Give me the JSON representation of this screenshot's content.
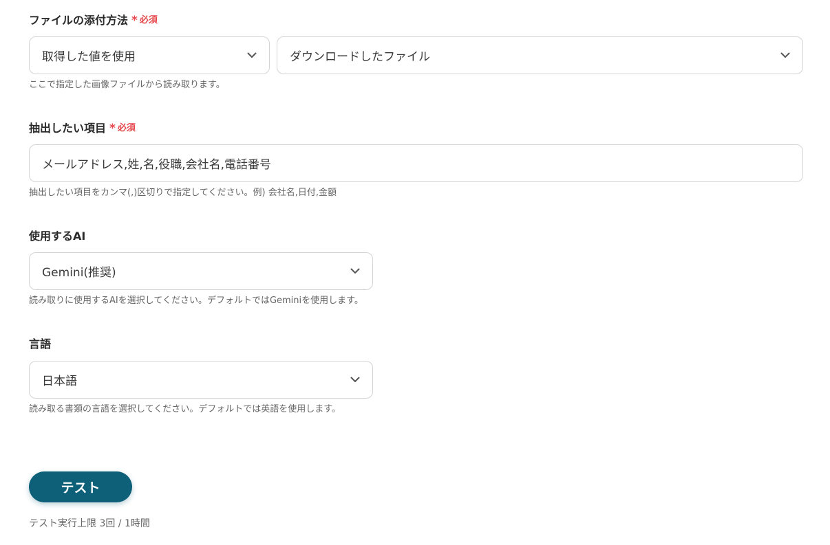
{
  "attachment": {
    "label": "ファイルの添付方法",
    "required_mark": "*",
    "required_text": "必須",
    "method_value": "取得した値を使用",
    "file_value": "ダウンロードしたファイル",
    "help": "ここで指定した画像ファイルから読み取ります。"
  },
  "extract": {
    "label": "抽出したい項目",
    "required_mark": "*",
    "required_text": "必須",
    "value": "メールアドレス,姓,名,役職,会社名,電話番号",
    "help": "抽出したい項目をカンマ(,)区切りで指定してください。例) 会社名,日付,金額"
  },
  "ai": {
    "label": "使用するAI",
    "value": "Gemini(推奨)",
    "help": "読み取りに使用するAIを選択してください。デフォルトではGeminiを使用します。"
  },
  "language": {
    "label": "言語",
    "value": "日本語",
    "help": "読み取る書類の言語を選択してください。デフォルトでは英語を使用します。"
  },
  "test": {
    "button_label": "テスト",
    "limit_text": "テスト実行上限 3回 / 1時間"
  },
  "colors": {
    "required": "#e5484d",
    "button_bg": "#0e5f78",
    "border": "#d4d4d4"
  },
  "icons": {
    "dropdown": "chevron-down-icon"
  }
}
